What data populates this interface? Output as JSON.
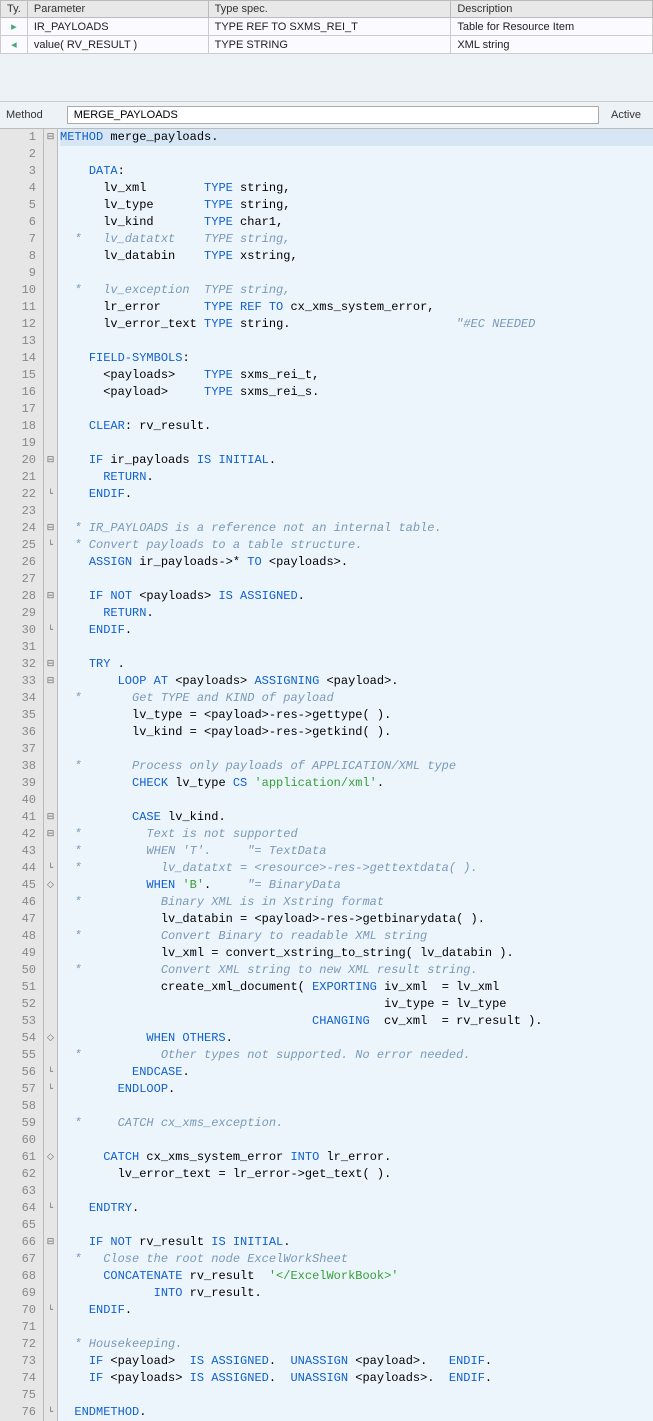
{
  "params_table": {
    "headers": [
      "Ty.",
      "Parameter",
      "Type spec.",
      "Description"
    ],
    "rows": [
      {
        "icon": "import-icon",
        "param": "IR_PAYLOADS",
        "type": "TYPE REF TO SXMS_REI_T",
        "desc": "Table for Resource Item"
      },
      {
        "icon": "returning-icon",
        "param": "value( RV_RESULT )",
        "type": "TYPE STRING",
        "desc": "XML string"
      }
    ]
  },
  "method_header": {
    "label": "Method",
    "name": "MERGE_PAYLOADS",
    "status": "Active"
  },
  "fold_glyphs": {
    "minus": "⊟",
    "plus": "⊞",
    "end": "└",
    "dot": "◇"
  },
  "code_lines": [
    {
      "n": 1,
      "fold": "minus",
      "first": true,
      "tokens": [
        [
          "kw",
          "METHOD"
        ],
        [
          "id",
          " merge_payloads"
        ],
        [
          "op",
          "."
        ]
      ]
    },
    {
      "n": 2,
      "tokens": []
    },
    {
      "n": 3,
      "tokens": [
        [
          "sp",
          "    "
        ],
        [
          "kw",
          "DATA"
        ],
        [
          "op",
          ":"
        ]
      ]
    },
    {
      "n": 4,
      "tokens": [
        [
          "sp",
          "      "
        ],
        [
          "id",
          "lv_xml        "
        ],
        [
          "kw",
          "TYPE"
        ],
        [
          "id",
          " string"
        ],
        [
          "op",
          ","
        ]
      ]
    },
    {
      "n": 5,
      "tokens": [
        [
          "sp",
          "      "
        ],
        [
          "id",
          "lv_type       "
        ],
        [
          "kw",
          "TYPE"
        ],
        [
          "id",
          " string"
        ],
        [
          "op",
          ","
        ]
      ]
    },
    {
      "n": 6,
      "tokens": [
        [
          "sp",
          "      "
        ],
        [
          "id",
          "lv_kind       "
        ],
        [
          "kw",
          "TYPE"
        ],
        [
          "id",
          " char1"
        ],
        [
          "op",
          ","
        ]
      ]
    },
    {
      "n": 7,
      "tokens": [
        [
          "cmt",
          "  *   lv_datatxt    TYPE string,"
        ]
      ]
    },
    {
      "n": 8,
      "tokens": [
        [
          "sp",
          "      "
        ],
        [
          "id",
          "lv_databin    "
        ],
        [
          "kw",
          "TYPE"
        ],
        [
          "id",
          " xstring"
        ],
        [
          "op",
          ","
        ]
      ]
    },
    {
      "n": 9,
      "tokens": []
    },
    {
      "n": 10,
      "tokens": [
        [
          "cmt",
          "  *   lv_exception  TYPE string,"
        ]
      ]
    },
    {
      "n": 11,
      "tokens": [
        [
          "sp",
          "      "
        ],
        [
          "id",
          "lr_error      "
        ],
        [
          "kw",
          "TYPE REF TO"
        ],
        [
          "id",
          " cx_xms_system_error"
        ],
        [
          "op",
          ","
        ]
      ]
    },
    {
      "n": 12,
      "tokens": [
        [
          "sp",
          "      "
        ],
        [
          "id",
          "lv_error_text "
        ],
        [
          "kw",
          "TYPE"
        ],
        [
          "id",
          " string"
        ],
        [
          "op",
          "."
        ],
        [
          "sp",
          "                       "
        ],
        [
          "pragma",
          "\"#EC NEEDED"
        ]
      ]
    },
    {
      "n": 13,
      "tokens": []
    },
    {
      "n": 14,
      "tokens": [
        [
          "sp",
          "    "
        ],
        [
          "kw",
          "FIELD-SYMBOLS"
        ],
        [
          "op",
          ":"
        ]
      ]
    },
    {
      "n": 15,
      "tokens": [
        [
          "sp",
          "      "
        ],
        [
          "id",
          "<payloads>    "
        ],
        [
          "kw",
          "TYPE"
        ],
        [
          "id",
          " sxms_rei_t"
        ],
        [
          "op",
          ","
        ]
      ]
    },
    {
      "n": 16,
      "tokens": [
        [
          "sp",
          "      "
        ],
        [
          "id",
          "<payload>     "
        ],
        [
          "kw",
          "TYPE"
        ],
        [
          "id",
          " sxms_rei_s"
        ],
        [
          "op",
          "."
        ]
      ]
    },
    {
      "n": 17,
      "tokens": []
    },
    {
      "n": 18,
      "tokens": [
        [
          "sp",
          "    "
        ],
        [
          "kw",
          "CLEAR"
        ],
        [
          "op",
          ": "
        ],
        [
          "id",
          "rv_result"
        ],
        [
          "op",
          "."
        ]
      ]
    },
    {
      "n": 19,
      "tokens": []
    },
    {
      "n": 20,
      "fold": "minus",
      "tokens": [
        [
          "sp",
          "    "
        ],
        [
          "kw",
          "IF"
        ],
        [
          "id",
          " ir_payloads "
        ],
        [
          "kw",
          "IS INITIAL"
        ],
        [
          "op",
          "."
        ]
      ]
    },
    {
      "n": 21,
      "tokens": [
        [
          "sp",
          "      "
        ],
        [
          "kw",
          "RETURN"
        ],
        [
          "op",
          "."
        ]
      ]
    },
    {
      "n": 22,
      "fold": "end",
      "tokens": [
        [
          "sp",
          "    "
        ],
        [
          "kw",
          "ENDIF"
        ],
        [
          "op",
          "."
        ]
      ]
    },
    {
      "n": 23,
      "tokens": []
    },
    {
      "n": 24,
      "fold": "minus",
      "tokens": [
        [
          "cmt",
          "  * IR_PAYLOADS is a reference not an internal table."
        ]
      ]
    },
    {
      "n": 25,
      "fold": "end",
      "tokens": [
        [
          "cmt",
          "  * Convert payloads to a table structure."
        ]
      ]
    },
    {
      "n": 26,
      "tokens": [
        [
          "sp",
          "    "
        ],
        [
          "kw",
          "ASSIGN"
        ],
        [
          "id",
          " ir_payloads"
        ],
        [
          "op",
          "->* "
        ],
        [
          "kw",
          "TO"
        ],
        [
          "id",
          " <payloads>"
        ],
        [
          "op",
          "."
        ]
      ]
    },
    {
      "n": 27,
      "tokens": []
    },
    {
      "n": 28,
      "fold": "minus",
      "tokens": [
        [
          "sp",
          "    "
        ],
        [
          "kw",
          "IF NOT"
        ],
        [
          "id",
          " <payloads> "
        ],
        [
          "kw",
          "IS ASSIGNED"
        ],
        [
          "op",
          "."
        ]
      ]
    },
    {
      "n": 29,
      "tokens": [
        [
          "sp",
          "      "
        ],
        [
          "kw",
          "RETURN"
        ],
        [
          "op",
          "."
        ]
      ]
    },
    {
      "n": 30,
      "fold": "end",
      "tokens": [
        [
          "sp",
          "    "
        ],
        [
          "kw",
          "ENDIF"
        ],
        [
          "op",
          "."
        ]
      ]
    },
    {
      "n": 31,
      "tokens": []
    },
    {
      "n": 32,
      "fold": "minus",
      "tokens": [
        [
          "sp",
          "    "
        ],
        [
          "kw",
          "TRY"
        ],
        [
          "id",
          " "
        ],
        [
          "op",
          "."
        ]
      ]
    },
    {
      "n": 33,
      "fold": "minus",
      "tokens": [
        [
          "sp",
          "        "
        ],
        [
          "kw",
          "LOOP AT"
        ],
        [
          "id",
          " <payloads> "
        ],
        [
          "kw",
          "ASSIGNING"
        ],
        [
          "id",
          " <payload>"
        ],
        [
          "op",
          "."
        ]
      ]
    },
    {
      "n": 34,
      "tokens": [
        [
          "cmt",
          "  *       Get TYPE and KIND of payload"
        ]
      ]
    },
    {
      "n": 35,
      "tokens": [
        [
          "sp",
          "          "
        ],
        [
          "id",
          "lv_type "
        ],
        [
          "op",
          "= "
        ],
        [
          "id",
          "<payload>"
        ],
        [
          "op",
          "-"
        ],
        [
          "id",
          "res"
        ],
        [
          "op",
          "->"
        ],
        [
          "id",
          "gettype"
        ],
        [
          "op",
          "( )."
        ]
      ]
    },
    {
      "n": 36,
      "tokens": [
        [
          "sp",
          "          "
        ],
        [
          "id",
          "lv_kind "
        ],
        [
          "op",
          "= "
        ],
        [
          "id",
          "<payload>"
        ],
        [
          "op",
          "-"
        ],
        [
          "id",
          "res"
        ],
        [
          "op",
          "->"
        ],
        [
          "id",
          "getkind"
        ],
        [
          "op",
          "( )."
        ]
      ]
    },
    {
      "n": 37,
      "tokens": []
    },
    {
      "n": 38,
      "tokens": [
        [
          "cmt",
          "  *       Process only payloads of APPLICATION/XML type"
        ]
      ]
    },
    {
      "n": 39,
      "tokens": [
        [
          "sp",
          "          "
        ],
        [
          "kw",
          "CHECK"
        ],
        [
          "id",
          " lv_type "
        ],
        [
          "kw",
          "CS"
        ],
        [
          "id",
          " "
        ],
        [
          "str",
          "'application/xml'"
        ],
        [
          "op",
          "."
        ]
      ]
    },
    {
      "n": 40,
      "tokens": []
    },
    {
      "n": 41,
      "fold": "minus",
      "tokens": [
        [
          "sp",
          "          "
        ],
        [
          "kw",
          "CASE"
        ],
        [
          "id",
          " lv_kind"
        ],
        [
          "op",
          "."
        ]
      ]
    },
    {
      "n": 42,
      "fold": "minus",
      "tokens": [
        [
          "cmt",
          "  *         Text is not supported"
        ]
      ]
    },
    {
      "n": 43,
      "tokens": [
        [
          "cmt",
          "  *         WHEN 'T'.     \"= TextData"
        ]
      ]
    },
    {
      "n": 44,
      "fold": "end",
      "tokens": [
        [
          "cmt",
          "  *           lv_datatxt = <resource>-res->gettextdata( )."
        ]
      ]
    },
    {
      "n": 45,
      "fold": "dot",
      "tokens": [
        [
          "sp",
          "            "
        ],
        [
          "kw",
          "WHEN"
        ],
        [
          "id",
          " "
        ],
        [
          "str",
          "'B'"
        ],
        [
          "op",
          "."
        ],
        [
          "id",
          "     "
        ],
        [
          "cmt",
          "\"= BinaryData"
        ]
      ]
    },
    {
      "n": 46,
      "tokens": [
        [
          "cmt",
          "  *           Binary XML is in Xstring format"
        ]
      ]
    },
    {
      "n": 47,
      "tokens": [
        [
          "sp",
          "              "
        ],
        [
          "id",
          "lv_databin "
        ],
        [
          "op",
          "= "
        ],
        [
          "id",
          "<payload>"
        ],
        [
          "op",
          "-"
        ],
        [
          "id",
          "res"
        ],
        [
          "op",
          "->"
        ],
        [
          "id",
          "getbinarydata"
        ],
        [
          "op",
          "( )."
        ]
      ]
    },
    {
      "n": 48,
      "tokens": [
        [
          "cmt",
          "  *           Convert Binary to readable XML string"
        ]
      ]
    },
    {
      "n": 49,
      "tokens": [
        [
          "sp",
          "              "
        ],
        [
          "id",
          "lv_xml "
        ],
        [
          "op",
          "= "
        ],
        [
          "id",
          "convert_xstring_to_string"
        ],
        [
          "op",
          "( "
        ],
        [
          "id",
          "lv_databin"
        ],
        [
          "op",
          " )."
        ]
      ]
    },
    {
      "n": 50,
      "tokens": [
        [
          "cmt",
          "  *           Convert XML string to new XML result string."
        ]
      ]
    },
    {
      "n": 51,
      "tokens": [
        [
          "sp",
          "              "
        ],
        [
          "id",
          "create_xml_document"
        ],
        [
          "op",
          "( "
        ],
        [
          "kw",
          "EXPORTING"
        ],
        [
          "id",
          " iv_xml  "
        ],
        [
          "op",
          "= "
        ],
        [
          "id",
          "lv_xml"
        ]
      ]
    },
    {
      "n": 52,
      "tokens": [
        [
          "sp",
          "                                             "
        ],
        [
          "id",
          "iv_type "
        ],
        [
          "op",
          "= "
        ],
        [
          "id",
          "lv_type"
        ]
      ]
    },
    {
      "n": 53,
      "tokens": [
        [
          "sp",
          "                                   "
        ],
        [
          "kw",
          "CHANGING"
        ],
        [
          "id",
          "  cv_xml  "
        ],
        [
          "op",
          "= "
        ],
        [
          "id",
          "rv_result"
        ],
        [
          "op",
          " )."
        ]
      ]
    },
    {
      "n": 54,
      "fold": "dot",
      "tokens": [
        [
          "sp",
          "            "
        ],
        [
          "kw",
          "WHEN OTHERS"
        ],
        [
          "op",
          "."
        ]
      ]
    },
    {
      "n": 55,
      "tokens": [
        [
          "cmt",
          "  *           Other types not supported. No error needed."
        ]
      ]
    },
    {
      "n": 56,
      "fold": "end",
      "tokens": [
        [
          "sp",
          "          "
        ],
        [
          "kw",
          "ENDCASE"
        ],
        [
          "op",
          "."
        ]
      ]
    },
    {
      "n": 57,
      "fold": "end",
      "tokens": [
        [
          "sp",
          "        "
        ],
        [
          "kw",
          "ENDLOOP"
        ],
        [
          "op",
          "."
        ]
      ]
    },
    {
      "n": 58,
      "tokens": []
    },
    {
      "n": 59,
      "tokens": [
        [
          "cmt",
          "  *     CATCH cx_xms_exception."
        ]
      ]
    },
    {
      "n": 60,
      "tokens": []
    },
    {
      "n": 61,
      "fold": "dot",
      "tokens": [
        [
          "sp",
          "      "
        ],
        [
          "kw",
          "CATCH"
        ],
        [
          "id",
          " cx_xms_system_error "
        ],
        [
          "kw",
          "INTO"
        ],
        [
          "id",
          " lr_error"
        ],
        [
          "op",
          "."
        ]
      ]
    },
    {
      "n": 62,
      "tokens": [
        [
          "sp",
          "        "
        ],
        [
          "id",
          "lv_error_text "
        ],
        [
          "op",
          "= "
        ],
        [
          "id",
          "lr_error"
        ],
        [
          "op",
          "->"
        ],
        [
          "id",
          "get_text"
        ],
        [
          "op",
          "( )."
        ]
      ]
    },
    {
      "n": 63,
      "tokens": []
    },
    {
      "n": 64,
      "fold": "end",
      "tokens": [
        [
          "sp",
          "    "
        ],
        [
          "kw",
          "ENDTRY"
        ],
        [
          "op",
          "."
        ]
      ]
    },
    {
      "n": 65,
      "tokens": []
    },
    {
      "n": 66,
      "fold": "minus",
      "tokens": [
        [
          "sp",
          "    "
        ],
        [
          "kw",
          "IF NOT"
        ],
        [
          "id",
          " rv_result "
        ],
        [
          "kw",
          "IS INITIAL"
        ],
        [
          "op",
          "."
        ]
      ]
    },
    {
      "n": 67,
      "tokens": [
        [
          "cmt",
          "  *   Close the root node ExcelWorkSheet"
        ]
      ]
    },
    {
      "n": 68,
      "tokens": [
        [
          "sp",
          "      "
        ],
        [
          "kw",
          "CONCATENATE"
        ],
        [
          "id",
          " rv_result  "
        ],
        [
          "str",
          "'</ExcelWorkBook>'"
        ]
      ]
    },
    {
      "n": 69,
      "tokens": [
        [
          "sp",
          "             "
        ],
        [
          "kw",
          "INTO"
        ],
        [
          "id",
          " rv_result"
        ],
        [
          "op",
          "."
        ]
      ]
    },
    {
      "n": 70,
      "fold": "end",
      "tokens": [
        [
          "sp",
          "    "
        ],
        [
          "kw",
          "ENDIF"
        ],
        [
          "op",
          "."
        ]
      ]
    },
    {
      "n": 71,
      "tokens": []
    },
    {
      "n": 72,
      "tokens": [
        [
          "cmt",
          "  * Housekeeping."
        ]
      ]
    },
    {
      "n": 73,
      "tokens": [
        [
          "sp",
          "    "
        ],
        [
          "kw",
          "IF"
        ],
        [
          "id",
          " <payload>  "
        ],
        [
          "kw",
          "IS ASSIGNED"
        ],
        [
          "op",
          ".  "
        ],
        [
          "kw",
          "UNASSIGN"
        ],
        [
          "id",
          " <payload>"
        ],
        [
          "op",
          ".   "
        ],
        [
          "kw",
          "ENDIF"
        ],
        [
          "op",
          "."
        ]
      ]
    },
    {
      "n": 74,
      "tokens": [
        [
          "sp",
          "    "
        ],
        [
          "kw",
          "IF"
        ],
        [
          "id",
          " <payloads> "
        ],
        [
          "kw",
          "IS ASSIGNED"
        ],
        [
          "op",
          ".  "
        ],
        [
          "kw",
          "UNASSIGN"
        ],
        [
          "id",
          " <payloads>"
        ],
        [
          "op",
          ".  "
        ],
        [
          "kw",
          "ENDIF"
        ],
        [
          "op",
          "."
        ]
      ]
    },
    {
      "n": 75,
      "tokens": []
    },
    {
      "n": 76,
      "fold": "end",
      "tokens": [
        [
          "sp",
          "  "
        ],
        [
          "kw",
          "ENDMETHOD"
        ],
        [
          "op",
          "."
        ]
      ]
    }
  ]
}
